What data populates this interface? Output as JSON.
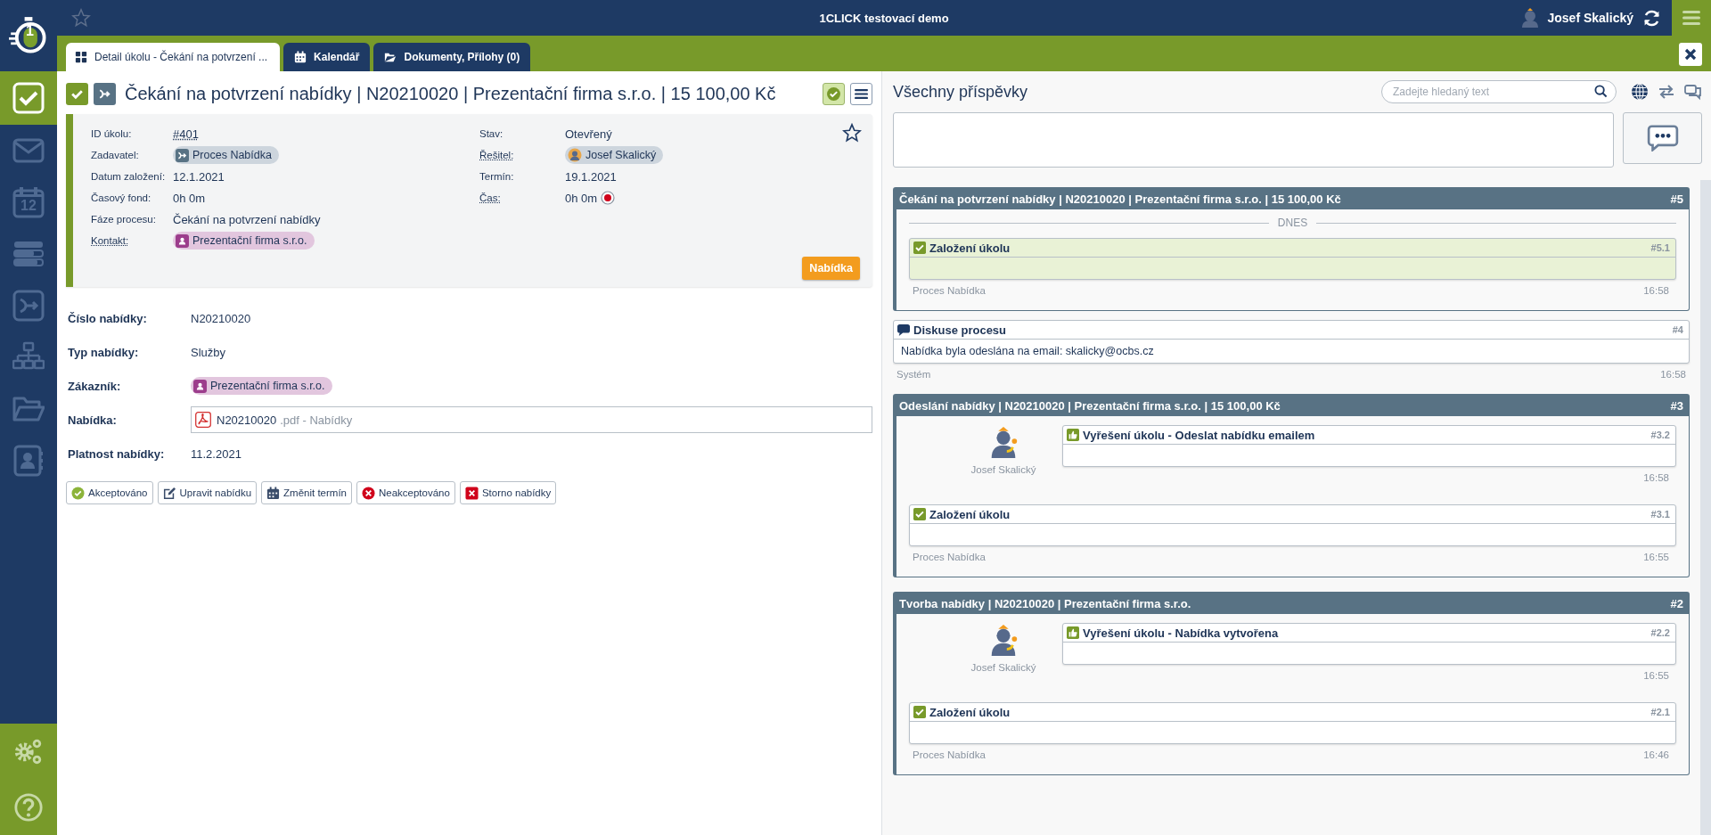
{
  "header": {
    "logo": "1",
    "title": "1CLICK testovací demo",
    "user": "Josef Skalický",
    "favorite": false
  },
  "sidebar": {
    "items": [
      {
        "kind": "tasks",
        "selected": true
      },
      {
        "kind": "mail",
        "selected": false
      },
      {
        "kind": "calendar",
        "selected": false,
        "text": "12"
      },
      {
        "kind": "list",
        "selected": false
      },
      {
        "kind": "process",
        "selected": false
      },
      {
        "kind": "org",
        "selected": false
      },
      {
        "kind": "folder",
        "selected": false
      },
      {
        "kind": "contacts",
        "selected": false
      }
    ],
    "bottom": [
      {
        "kind": "settings"
      },
      {
        "kind": "help"
      }
    ]
  },
  "tabs": [
    {
      "label": "Detail úkolu - Čekání na potvrzení ...",
      "selected": true
    },
    {
      "label": "Kalendář",
      "selected": false
    },
    {
      "label": "Dokumenty, Přílohy (0)",
      "selected": false
    }
  ],
  "task": {
    "title": "Čekání na potvrzení nabídky | N20210020 | Prezentační firma s.r.o. | 15 100,00 Kč",
    "completed": true,
    "favorite": false,
    "info_left": [
      {
        "label": "ID úkolu:",
        "kind": "link",
        "value": "#401",
        "dotted": false
      },
      {
        "label": "Zadavatel:",
        "kind": "process",
        "value": "Proces Nabídka",
        "dotted": false
      },
      {
        "label": "Datum založení:",
        "kind": "text",
        "value": "12.1.2021",
        "dotted": false
      },
      {
        "label": "Časový fond:",
        "kind": "text",
        "value": "0h 0m",
        "dotted": false
      },
      {
        "label": "Fáze procesu:",
        "kind": "text",
        "value": "Čekání na potvrzení nabídky",
        "dotted": false
      },
      {
        "label": "Kontakt:",
        "kind": "contact",
        "value": "Prezentační firma s.r.o.",
        "dotted": true
      }
    ],
    "info_right": [
      {
        "label": "Stav:",
        "kind": "text",
        "value": "Otevřený",
        "dotted": false
      },
      {
        "label": "Řešitel:",
        "kind": "user",
        "value": "Josef Skalický",
        "dotted": true
      },
      {
        "label": "Termín:",
        "kind": "text",
        "value": "19.1.2021",
        "dotted": false
      },
      {
        "label": "Čas:",
        "kind": "timer",
        "value": "0h 0m",
        "dotted": true
      }
    ],
    "phase_button": "Nabídka"
  },
  "form": [
    {
      "label": "Číslo nabídky:",
      "kind": "text",
      "value": "N20210020"
    },
    {
      "label": "Typ nabídky:",
      "kind": "text",
      "value": "Služby"
    },
    {
      "label": "Zákazník:",
      "kind": "contact",
      "value": "Prezentační firma s.r.o."
    },
    {
      "label": "Nabídka:",
      "kind": "file",
      "value": "N20210020",
      "suffix": ".pdf - Nabídky"
    },
    {
      "label": "Platnost nabídky:",
      "kind": "text",
      "value": "11.2.2021"
    }
  ],
  "actions": [
    {
      "label": "Akceptováno",
      "kind": "accept"
    },
    {
      "label": "Upravit nabídku",
      "kind": "edit"
    },
    {
      "label": "Změnit termín",
      "kind": "date"
    },
    {
      "label": "Neakceptováno",
      "kind": "reject"
    },
    {
      "label": "Storno nabídky",
      "kind": "cancel"
    }
  ],
  "comments": {
    "title": "Všechny příspěvky",
    "search_placeholder": "Zadejte hledaný text",
    "feed": [
      {
        "kind": "group",
        "title": "Čekání na potvrzení nabídky | N20210020 | Prezentační firma s.r.o. | 15 100,00 Kč",
        "number": "#5",
        "divider": "DNES",
        "entries": [
          {
            "kind": "created",
            "title": "Založení úkolu",
            "number": "#5.1",
            "highlighted": true,
            "author": "Proces Nabídka",
            "time": "16:58"
          }
        ]
      },
      {
        "kind": "post",
        "title": "Diskuse procesu",
        "number": "#4",
        "body": "Nabídka byla odeslána na email: skalicky@ocbs.cz",
        "author": "Systém",
        "time": "16:58"
      },
      {
        "kind": "group",
        "title": "Odeslání nabídky | N20210020 | Prezentační firma s.r.o. | 15 100,00 Kč",
        "number": "#3",
        "entries": [
          {
            "kind": "resolved",
            "title": "Vyřešení úkolu - Odeslat nabídku emailem",
            "number": "#3.2",
            "highlighted": false,
            "author": "Josef Skalický",
            "time": "16:58"
          },
          {
            "kind": "created",
            "title": "Založení úkolu",
            "number": "#3.1",
            "highlighted": false,
            "author": "Proces Nabídka",
            "time": "16:55"
          }
        ]
      },
      {
        "kind": "group",
        "title": "Tvorba nabídky | N20210020 | Prezentační firma s.r.o.",
        "number": "#2",
        "entries": [
          {
            "kind": "resolved",
            "title": "Vyřešení úkolu - Nabídka vytvořena",
            "number": "#2.2",
            "highlighted": false,
            "author": "Josef Skalický",
            "time": "16:55"
          },
          {
            "kind": "created",
            "title": "Založení úkolu",
            "number": "#2.1",
            "highlighted": false,
            "author": "Proces Nabídka",
            "time": "16:46"
          }
        ]
      }
    ]
  }
}
